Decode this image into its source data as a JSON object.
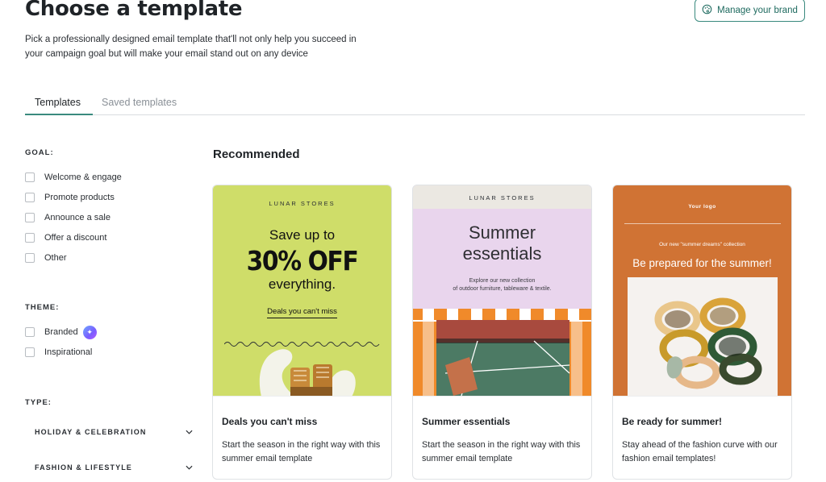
{
  "header": {
    "title": "Choose a template",
    "subtitle": "Pick a professionally designed email template that'll not only help you succeed in your campaign goal but will make your email stand out on any device",
    "brand_button": "Manage your brand"
  },
  "tabs": [
    {
      "label": "Templates",
      "active": true
    },
    {
      "label": "Saved templates",
      "active": false
    }
  ],
  "filters": {
    "goal": {
      "heading": "GOAL:",
      "options": [
        "Welcome & engage",
        "Promote products",
        "Announce a sale",
        "Offer a discount",
        "Other"
      ]
    },
    "theme": {
      "heading": "THEME:",
      "options": [
        "Branded",
        "Inspirational"
      ]
    },
    "type": {
      "heading": "TYPE:",
      "groups": [
        "HOLIDAY & CELEBRATION",
        "FASHION & LIFESTYLE"
      ]
    }
  },
  "recommended": {
    "title": "Recommended",
    "cards": [
      {
        "title": "Deals you can't miss",
        "description": "Start the season in the right way with this summer email template",
        "preview": {
          "store": "LUNAR STORES",
          "line1": "Save up to",
          "line2": "30% OFF",
          "line3": "everything.",
          "link": "Deals you can't miss",
          "bg": "#cfdd69"
        }
      },
      {
        "title": "Summer essentials",
        "description": "Start the season in the right way with this summer email template",
        "preview": {
          "store": "LUNAR STORES",
          "headline_1": "Summer",
          "headline_2": "essentials",
          "sub_1": "Explore our new collection",
          "sub_2": "of outdoor furniture, tableware & textile.",
          "bg": "#e9d5ed"
        }
      },
      {
        "title": "Be ready for summer!",
        "description": "Stay ahead of the fashion curve with our fashion email templates!",
        "preview": {
          "logo": "Your logo",
          "small": "Our new \"summer dreams\" collection",
          "big": "Be prepared for the summer!",
          "bg": "#d07334"
        }
      }
    ]
  },
  "colors": {
    "accent": "#3a8a7e",
    "brand_text": "#1e6a5f"
  }
}
